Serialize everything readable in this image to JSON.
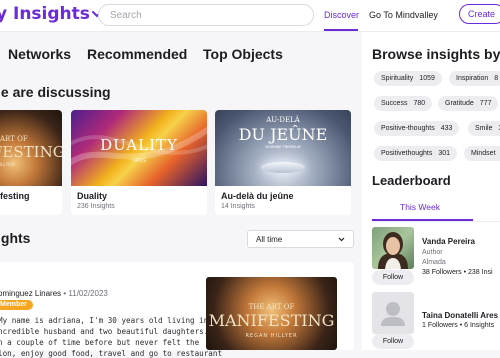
{
  "header": {
    "logo_text": "y Insights",
    "search_placeholder": "Search",
    "nav": [
      "Discover",
      "Go To Mindvalley"
    ],
    "create_label": "Create",
    "brand_color": "#6c2bd9"
  },
  "main": {
    "tabs": [
      "Networks",
      "Recommended",
      "Top Objects"
    ],
    "discussing_title": "le are discussing",
    "cards": [
      {
        "cover_text": [
          "ART OF",
          "FESTING",
          "ILLIYER"
        ],
        "title": "festing",
        "subtitle": ""
      },
      {
        "cover_text": [
          "DUALITY",
          "SIPRTS"
        ],
        "title": "Duality",
        "subtitle": "236 Insights"
      },
      {
        "cover_text": [
          "AU-DELÀ",
          "DU JEÛNE",
          "VIVIENNE TREMBLAY"
        ],
        "title": "Au-delà du jeûne",
        "subtitle": "14 Insights"
      }
    ],
    "insights_title": "ights",
    "filter_value": "All time",
    "post": {
      "author": "ominguez Linares",
      "date": " • 11/02/2023",
      "badge": "Member",
      "lines": [
        "My name is adriana, I'm 30 years old living in",
        "ncredible husband and two beautiful daughters. I",
        "n a couple of time before but never felt the",
        "lon, enjoy good food, travel and go to restaurant"
      ],
      "thumb_text": [
        "THE ART OF",
        "MANIFESTING",
        "REGAN HILLYER"
      ]
    }
  },
  "sidebar": {
    "browse_title": "Browse insights by",
    "chips": [
      {
        "label": "Spirituality",
        "count": "1059"
      },
      {
        "label": "Inspiration",
        "count": "8"
      },
      {
        "label": "Success",
        "count": "780"
      },
      {
        "label": "Gratitude",
        "count": "777"
      },
      {
        "label": "Positive-thoughts",
        "count": "433"
      },
      {
        "label": "Smile",
        "count": "3"
      },
      {
        "label": "Positivethoughts",
        "count": "301"
      },
      {
        "label": "Mindset",
        "count": ""
      }
    ],
    "leaderboard_title": "Leaderboard",
    "week_tab": "This Week",
    "people": [
      {
        "name": "Vanda Pereira",
        "role": "Author",
        "company": "Almada",
        "stats": "38 Followers • 238 Insi",
        "follow": "Follow"
      },
      {
        "name": "Taina Donatelli Ares",
        "role": "",
        "company": "",
        "stats": "1 Followers • 6 Insights",
        "follow": "Follow"
      }
    ]
  }
}
